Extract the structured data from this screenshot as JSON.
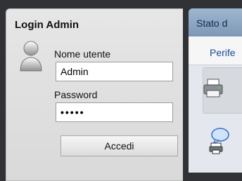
{
  "login": {
    "title": "Login Admin",
    "username_label": "Nome utente",
    "username_value": "Admin",
    "password_label": "Password",
    "password_value": "•••••",
    "submit_label": "Accedi"
  },
  "right_panel": {
    "header_title": "Stato d",
    "tab_label": "Perife"
  },
  "icons": {
    "user": "user-icon",
    "printer": "printer-icon",
    "job": "job-status-icon"
  }
}
